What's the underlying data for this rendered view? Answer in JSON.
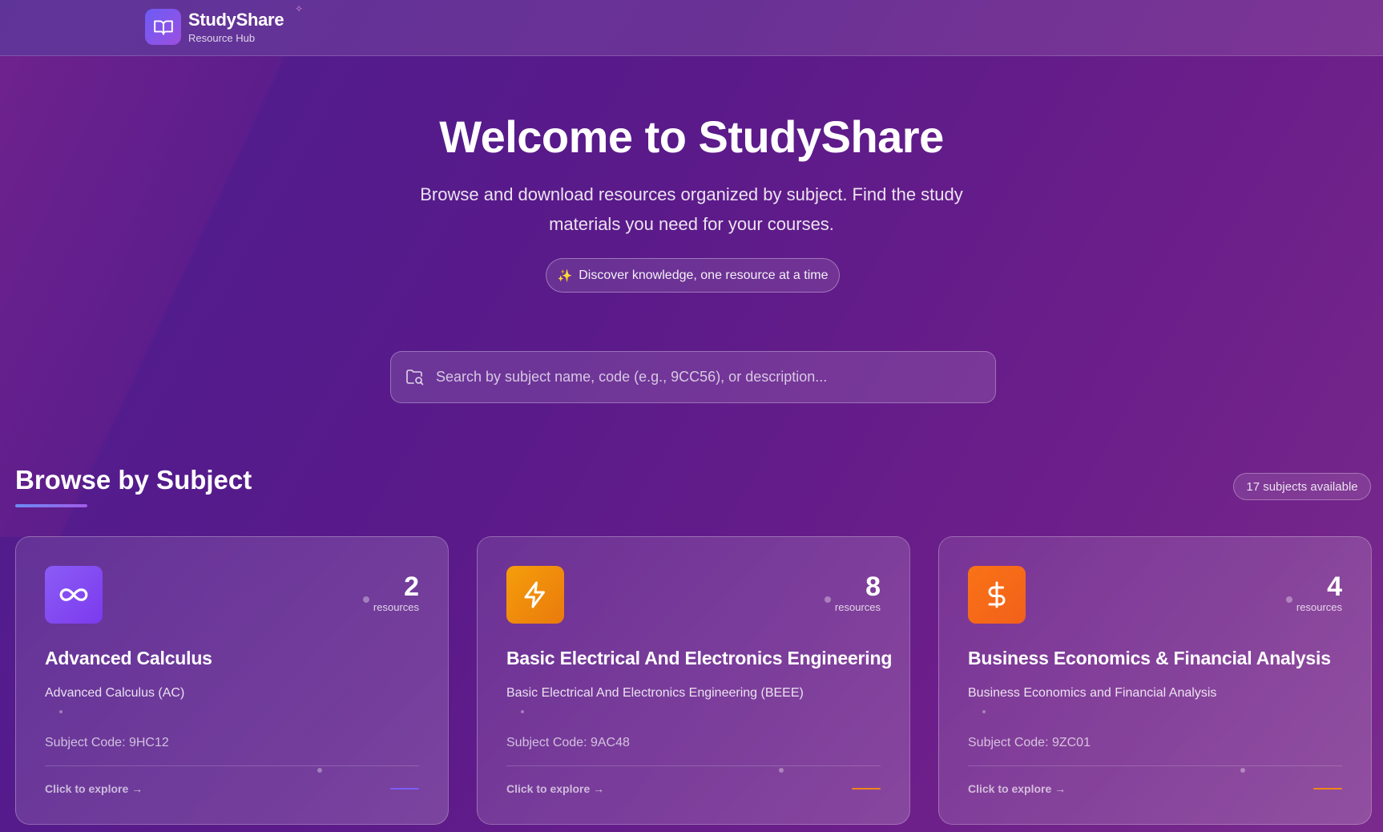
{
  "header": {
    "brand_name": "StudyShare",
    "brand_sub": "Resource Hub",
    "logo_icon": "open-book-icon"
  },
  "hero": {
    "title": "Welcome to StudyShare",
    "subtitle": "Browse and download resources organized by subject. Find the study materials you need for your courses.",
    "pill_text": "Discover knowledge, one resource at a time",
    "pill_icon": "sparkle-icon"
  },
  "search": {
    "placeholder": "Search by subject name, code (e.g., 9CC56), or description...",
    "value": "",
    "icon": "folder-search-icon"
  },
  "section": {
    "title": "Browse by Subject",
    "count_badge": "17 subjects available"
  },
  "colors": {
    "calculus": "#8b4cf0",
    "electrical": "#ec8a12",
    "economics": "#f46b1c",
    "accent_purple": "#7b5cf5",
    "accent_orange": "#f0851b"
  },
  "cards": [
    {
      "icon": "infinity-icon",
      "count": "2",
      "count_label": "resources",
      "title": "Advanced Calculus",
      "description": "Advanced Calculus (AC)",
      "code": "Subject Code: 9HC12",
      "link": "Click to explore →"
    },
    {
      "icon": "lightning-icon",
      "count": "8",
      "count_label": "resources",
      "title": "Basic Electrical And Electronics Engineering",
      "description": "Basic Electrical And Electronics Engineering (BEEE)",
      "code": "Subject Code: 9AC48",
      "link": "Click to explore →"
    },
    {
      "icon": "dollar-icon",
      "count": "4",
      "count_label": "resources",
      "title": "Business Economics & Financial Analysis",
      "description": "Business Economics and Financial Analysis",
      "code": "Subject Code: 9ZC01",
      "link": "Click to explore →"
    }
  ]
}
